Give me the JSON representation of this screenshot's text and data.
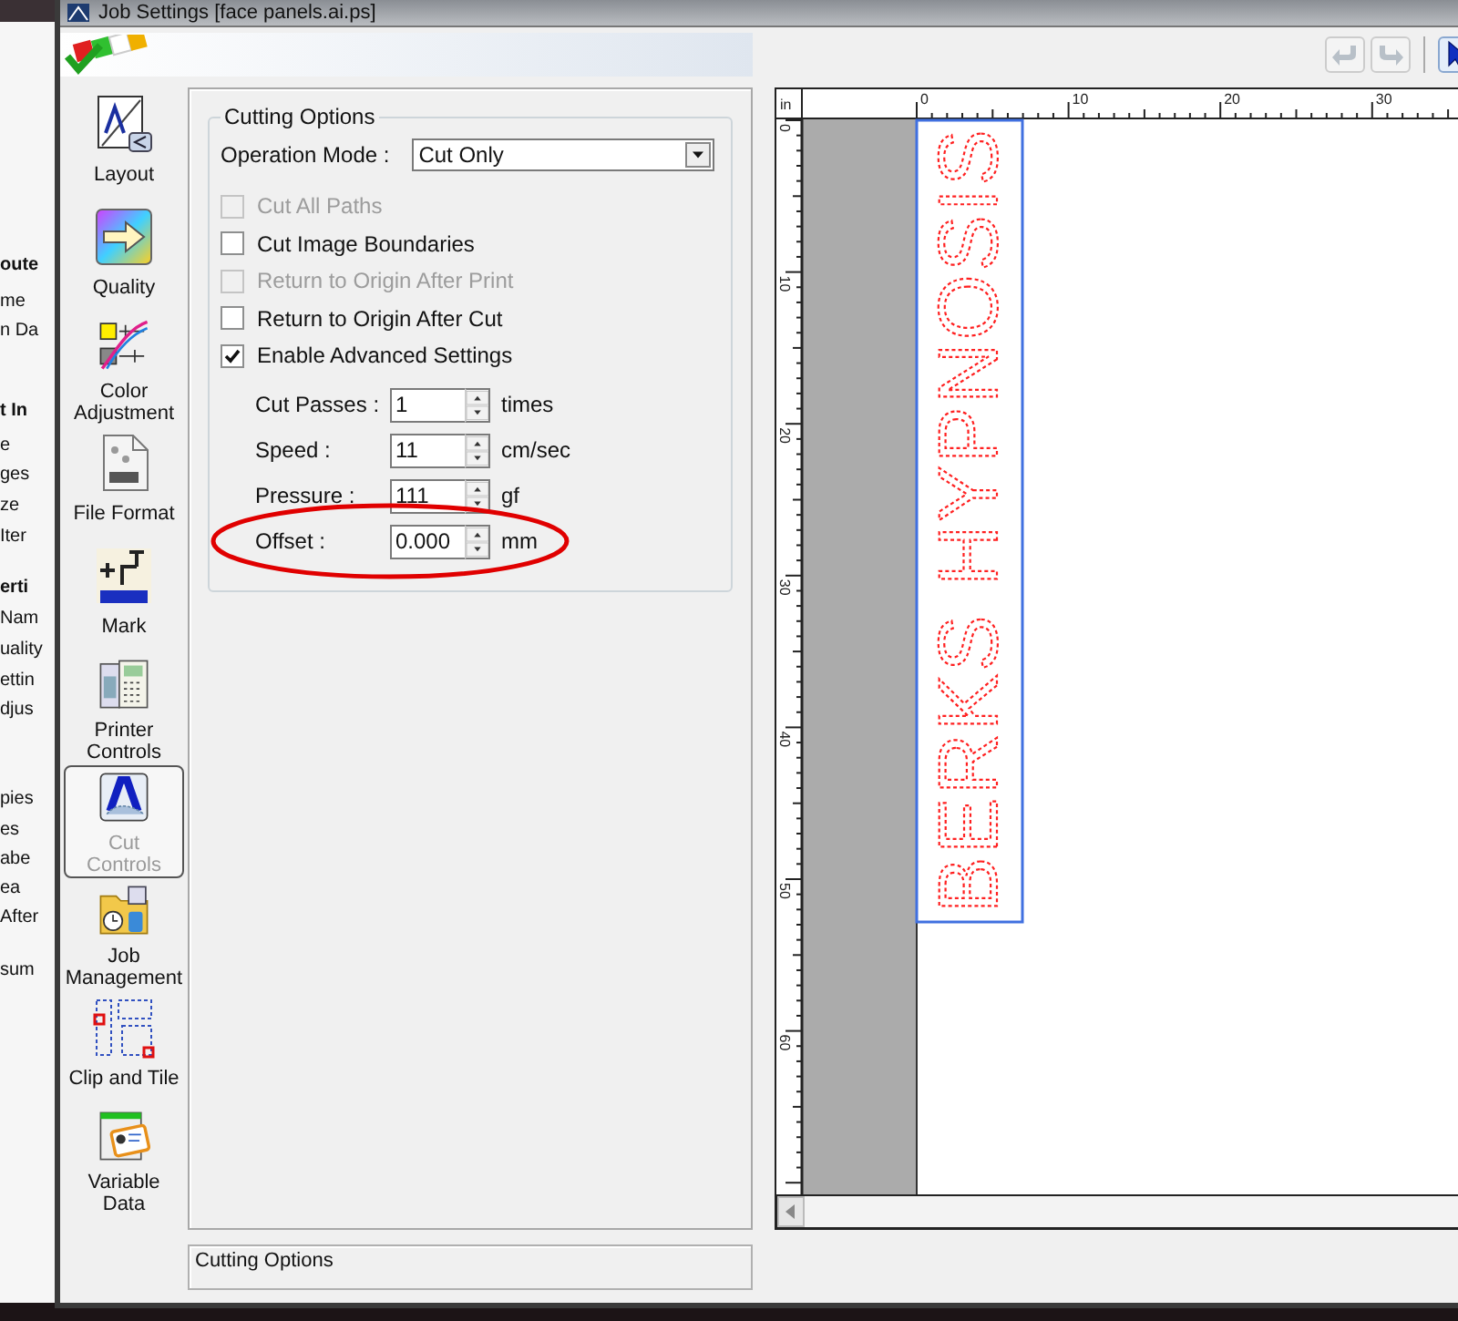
{
  "window": {
    "title": "Job Settings [face panels.ai.ps]"
  },
  "background_window": {
    "lines": [
      {
        "text": "oute",
        "kind": "heading"
      },
      {
        "text": "me",
        "kind": "item"
      },
      {
        "text": "n Da",
        "kind": "item"
      },
      {
        "text": "t In",
        "kind": "heading"
      },
      {
        "text": "e",
        "kind": "item"
      },
      {
        "text": "ges",
        "kind": "item"
      },
      {
        "text": "ze",
        "kind": "item"
      },
      {
        "text": "Iter",
        "kind": "item"
      },
      {
        "text": "erti",
        "kind": "heading"
      },
      {
        "text": "Nam",
        "kind": "item"
      },
      {
        "text": "uality",
        "kind": "item"
      },
      {
        "text": "ettin",
        "kind": "item"
      },
      {
        "text": "djus",
        "kind": "item"
      },
      {
        "text": "pies",
        "kind": "item"
      },
      {
        "text": "es",
        "kind": "item"
      },
      {
        "text": "abe",
        "kind": "item"
      },
      {
        "text": "ea",
        "kind": "item"
      },
      {
        "text": "After",
        "kind": "item"
      },
      {
        "text": "sum",
        "kind": "item"
      }
    ]
  },
  "toolbar": [
    {
      "kind": "undo",
      "disabled": true
    },
    {
      "kind": "redo",
      "disabled": true
    },
    {
      "kind": "pointer",
      "selected": true
    }
  ],
  "sidebar": {
    "items": [
      {
        "label": [
          "Layout"
        ],
        "selected": false
      },
      {
        "label": [
          "Quality"
        ],
        "selected": false
      },
      {
        "label": [
          "Color",
          "Adjustment"
        ],
        "selected": false
      },
      {
        "label": [
          "File Format"
        ],
        "selected": false
      },
      {
        "label": [
          "Mark"
        ],
        "selected": false
      },
      {
        "label": [
          "Printer",
          "Controls"
        ],
        "selected": false
      },
      {
        "label": [
          "Cut",
          "Controls"
        ],
        "selected": true
      },
      {
        "label": [
          "Job",
          "Management"
        ],
        "selected": false
      },
      {
        "label": [
          "Clip and Tile"
        ],
        "selected": false
      },
      {
        "label": [
          "Variable",
          "Data"
        ],
        "selected": false
      }
    ]
  },
  "cutting_options": {
    "title": "Cutting Options",
    "operation_mode": {
      "label": "Operation Mode :",
      "value": "Cut Only"
    },
    "checkboxes": [
      {
        "label": "Cut All Paths",
        "checked": false,
        "disabled": true
      },
      {
        "label": "Cut Image Boundaries",
        "checked": false,
        "disabled": false
      },
      {
        "label": "Return to Origin After Print",
        "checked": false,
        "disabled": true
      },
      {
        "label": "Return to Origin After Cut",
        "checked": false,
        "disabled": false
      },
      {
        "label": "Enable Advanced Settings",
        "checked": true,
        "disabled": false
      }
    ],
    "fields": [
      {
        "label": "Cut Passes :",
        "value": "1",
        "unit": "times",
        "circled": false
      },
      {
        "label": "Speed :",
        "value": "11",
        "unit": "cm/sec",
        "circled": false
      },
      {
        "label": "Pressure :",
        "value": "111",
        "unit": "gf",
        "circled": false
      },
      {
        "label": "Offset :",
        "value": "0.000",
        "unit": "mm",
        "circled": true
      }
    ]
  },
  "status_bar": {
    "text": "Cutting Options"
  },
  "preview": {
    "ruler_unit": "in",
    "horizontal_ruler": [
      "0",
      "10",
      "20",
      "30"
    ],
    "vertical_ruler": [
      "0",
      "10",
      "20",
      "30",
      "40",
      "50",
      "60"
    ],
    "artwork_text": "BERKS HYPNOSIS"
  }
}
